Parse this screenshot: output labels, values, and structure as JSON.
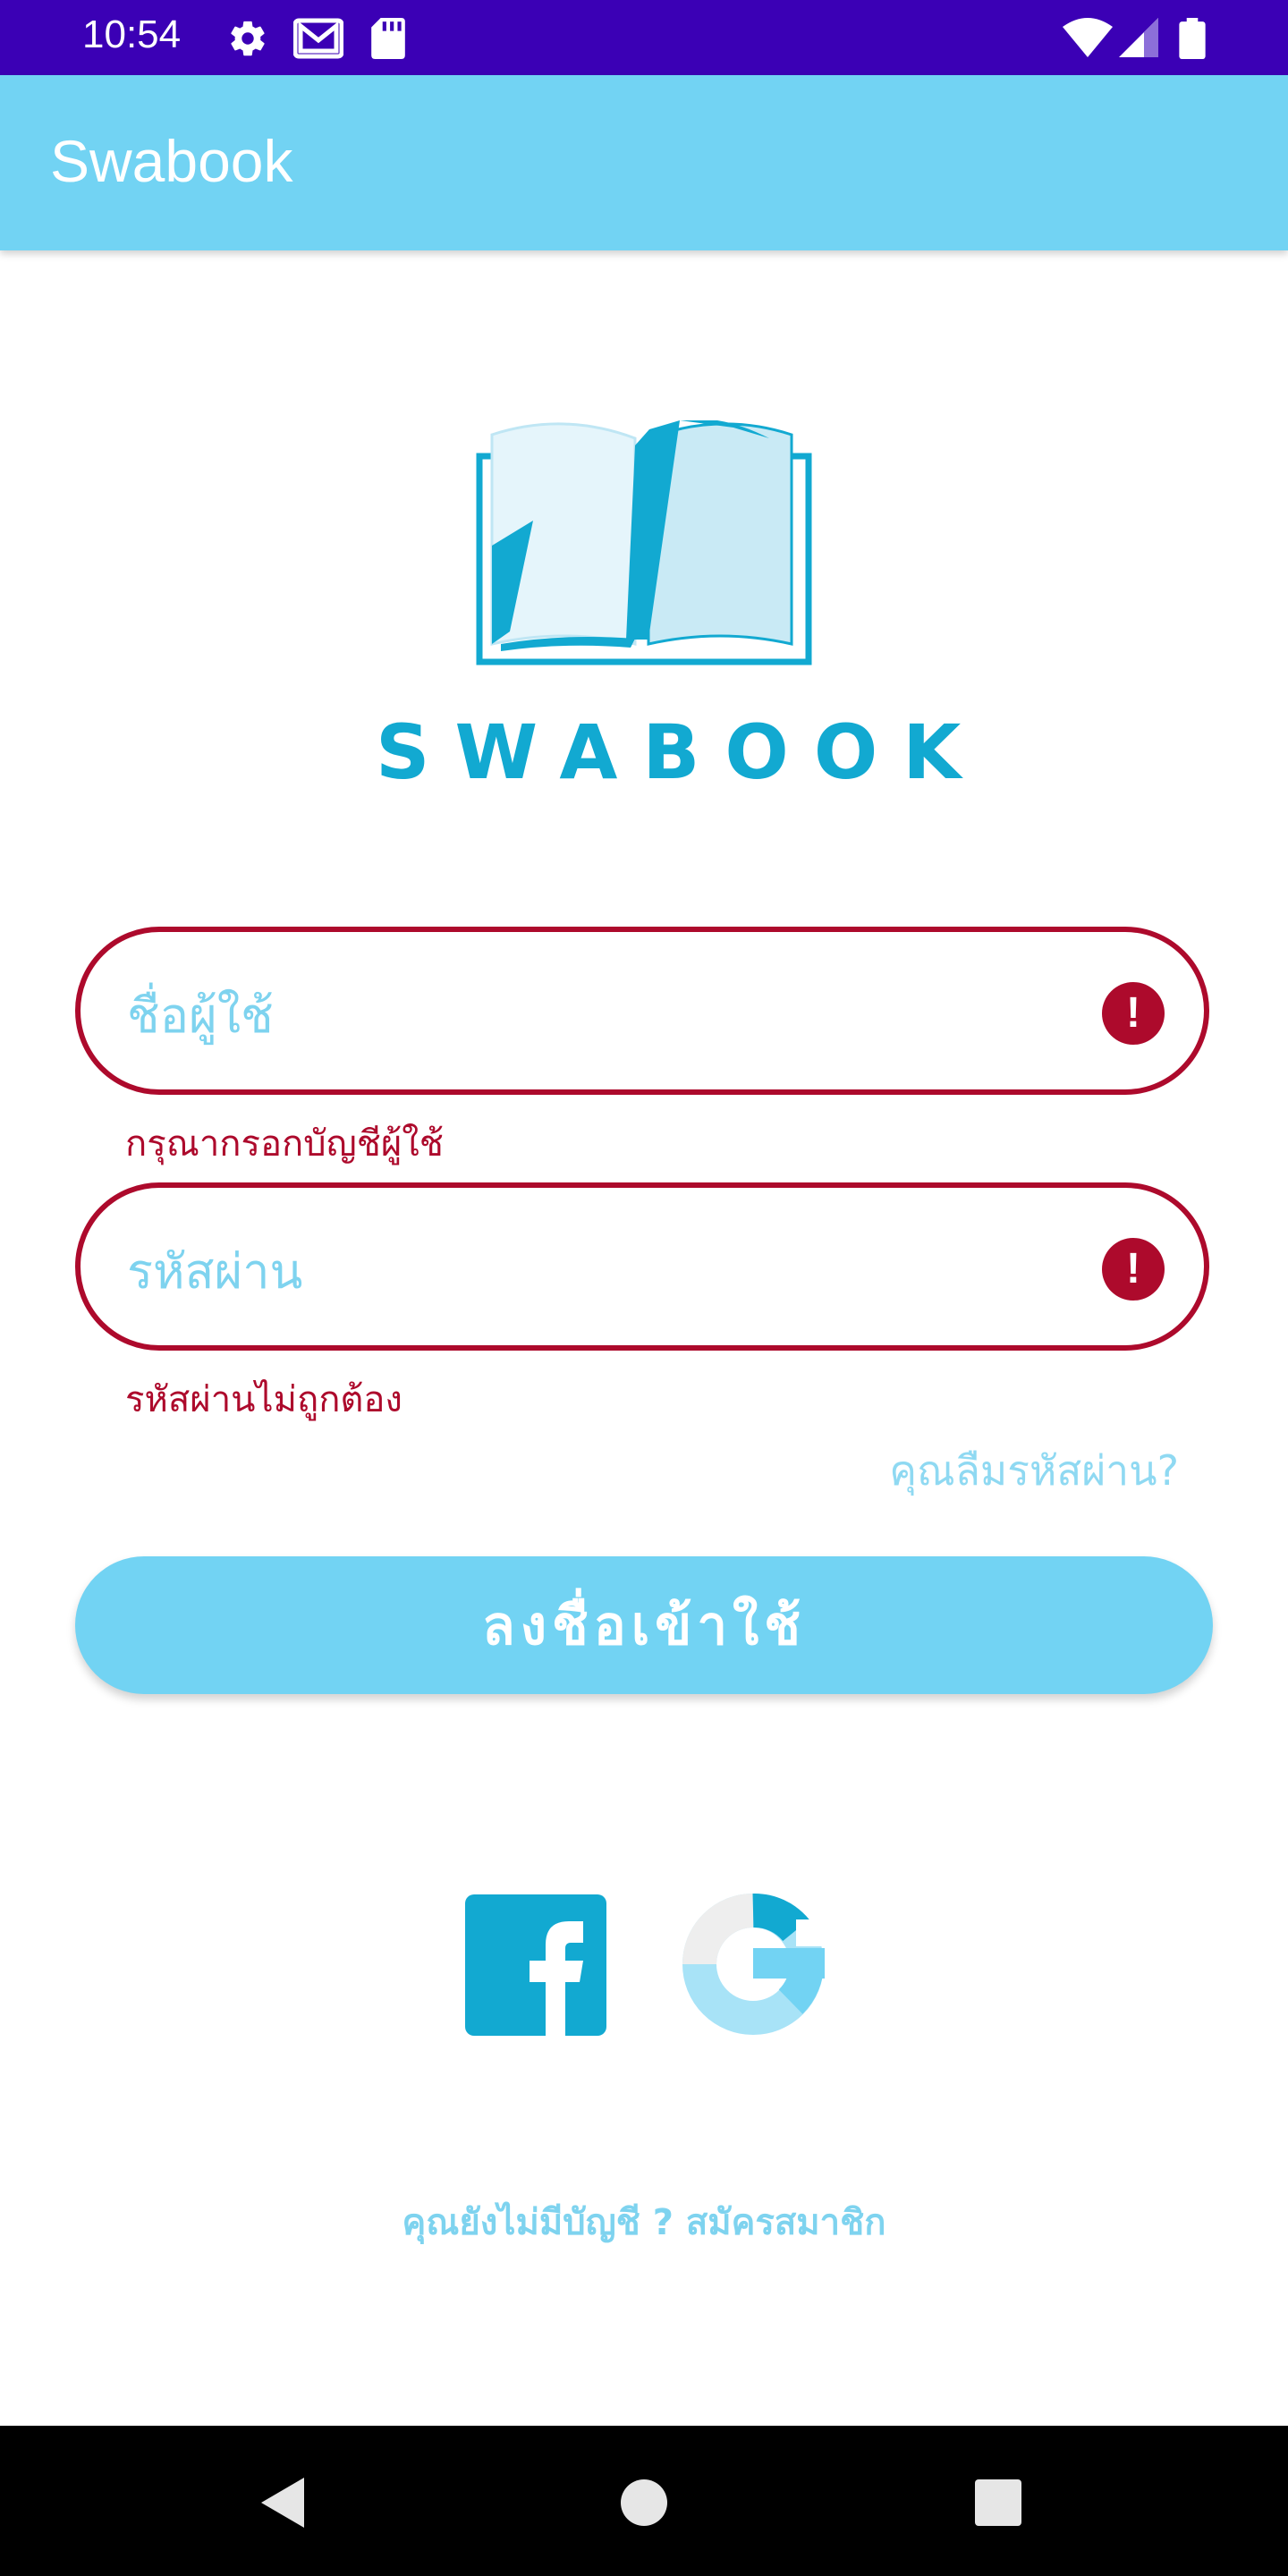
{
  "status_bar": {
    "time": "10:54",
    "icons_left": [
      "gear-icon",
      "gmail-icon",
      "sd-card-icon"
    ],
    "icons_right": [
      "wifi-icon",
      "cellular-signal-icon",
      "battery-icon"
    ]
  },
  "app_bar": {
    "title": "Swabook"
  },
  "logo": {
    "icon": "open-book-logo",
    "text": "SWABOOK"
  },
  "form": {
    "username": {
      "placeholder": "ชื่อผู้ใช้",
      "error_icon": "exclamation-icon",
      "error": "กรุณากรอกบัญชีผู้ใช้"
    },
    "password": {
      "placeholder": "รหัสผ่าน",
      "error_icon": "exclamation-icon",
      "error": "รหัสผ่านไม่ถูกต้อง"
    },
    "forgot_password": "คุณลืมรหัสผ่าน?",
    "login_button": "ลงชื่อเข้าใช้"
  },
  "social": {
    "icons": [
      "facebook-icon",
      "google-icon"
    ]
  },
  "signup": {
    "text": "คุณยังไม่มีบัญชี ? สมัครสมาชิก"
  },
  "nav_bar": {
    "icons": [
      "back-icon",
      "home-icon",
      "recents-icon"
    ]
  },
  "colors": {
    "status_bar": "#3b00b5",
    "accent": "#72d3f3",
    "brand": "#12a9d1",
    "error": "#ad0a2c"
  }
}
